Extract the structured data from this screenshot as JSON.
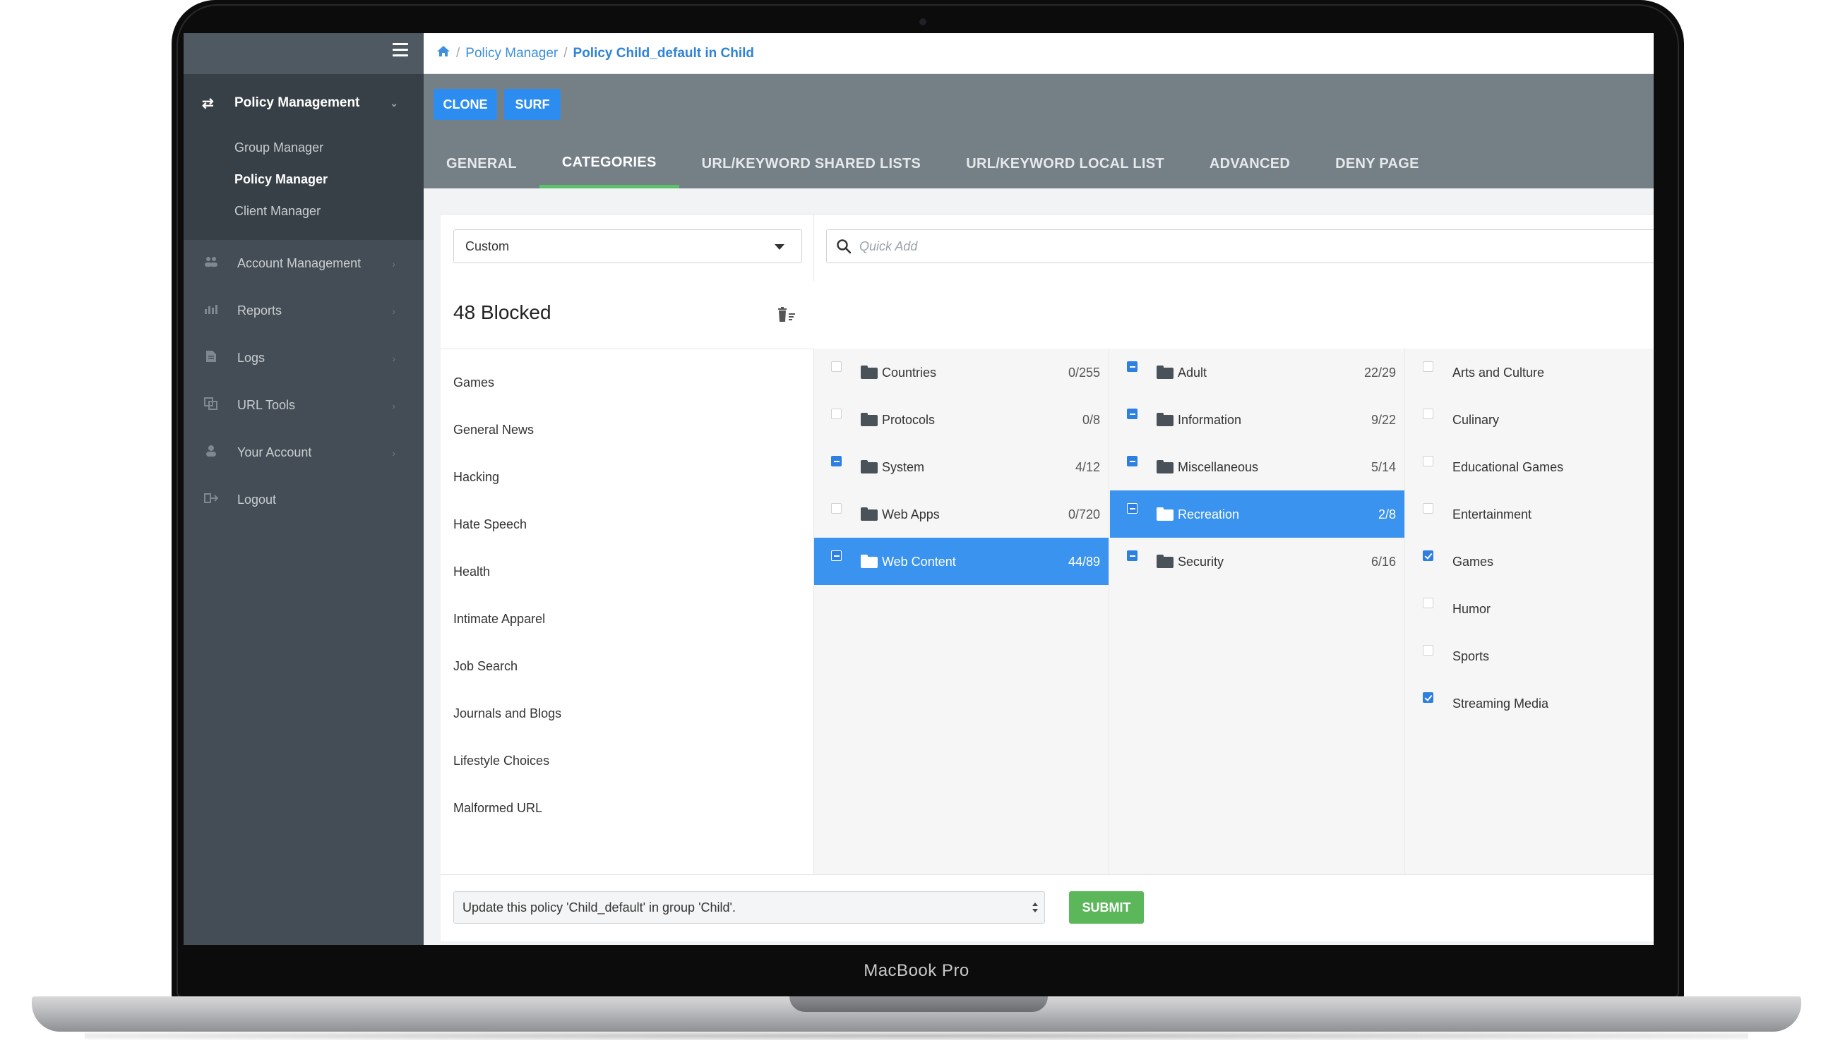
{
  "device": {
    "label": "MacBook Pro"
  },
  "breadcrumb": {
    "parent": "Policy Manager",
    "separator": "/",
    "current": "Policy Child_default in Child"
  },
  "sidebar": {
    "group": {
      "label": "Policy Management",
      "icon": "shuffle-icon",
      "items": [
        {
          "label": "Group Manager",
          "active": false
        },
        {
          "label": "Policy Manager",
          "active": true
        },
        {
          "label": "Client Manager",
          "active": false
        }
      ]
    },
    "items": [
      {
        "label": "Account Management",
        "icon": "users-icon"
      },
      {
        "label": "Reports",
        "icon": "bar-chart-icon"
      },
      {
        "label": "Logs",
        "icon": "file-icon"
      },
      {
        "label": "URL Tools",
        "icon": "copy-icon"
      },
      {
        "label": "Your Account",
        "icon": "user-icon"
      },
      {
        "label": "Logout",
        "icon": "sign-out-icon"
      }
    ]
  },
  "toolbar": {
    "clone_label": "CLONE",
    "surf_label": "SURF"
  },
  "tabs": [
    {
      "label": "GENERAL",
      "active": false
    },
    {
      "label": "CATEGORIES",
      "active": true
    },
    {
      "label": "URL/KEYWORD SHARED LISTS",
      "active": false
    },
    {
      "label": "URL/KEYWORD LOCAL LIST",
      "active": false
    },
    {
      "label": "ADVANCED",
      "active": false
    },
    {
      "label": "DENY PAGE",
      "active": false
    }
  ],
  "filter": {
    "selected": "Custom",
    "quick_add_placeholder": "Quick Add"
  },
  "blocked": {
    "title": "48 Blocked",
    "categories": [
      "Games",
      "General News",
      "Hacking",
      "Hate Speech",
      "Health",
      "Intimate Apparel",
      "Job Search",
      "Journals and Blogs",
      "Lifestyle Choices",
      "Malformed URL"
    ]
  },
  "columns": {
    "groups": [
      {
        "label": "Countries",
        "count": "0/255",
        "state": "none",
        "selected": false
      },
      {
        "label": "Protocols",
        "count": "0/8",
        "state": "none",
        "selected": false
      },
      {
        "label": "System",
        "count": "4/12",
        "state": "partial",
        "selected": false
      },
      {
        "label": "Web Apps",
        "count": "0/720",
        "state": "none",
        "selected": false
      },
      {
        "label": "Web Content",
        "count": "44/89",
        "state": "partial",
        "selected": true
      }
    ],
    "subgroups": [
      {
        "label": "Adult",
        "count": "22/29",
        "state": "partial",
        "selected": false
      },
      {
        "label": "Information",
        "count": "9/22",
        "state": "partial",
        "selected": false
      },
      {
        "label": "Miscellaneous",
        "count": "5/14",
        "state": "partial",
        "selected": false
      },
      {
        "label": "Recreation",
        "count": "2/8",
        "state": "partial",
        "selected": true
      },
      {
        "label": "Security",
        "count": "6/16",
        "state": "partial",
        "selected": false
      }
    ],
    "leaves": [
      {
        "label": "Arts and Culture",
        "checked": false
      },
      {
        "label": "Culinary",
        "checked": false
      },
      {
        "label": "Educational Games",
        "checked": false
      },
      {
        "label": "Entertainment",
        "checked": false
      },
      {
        "label": "Games",
        "checked": true
      },
      {
        "label": "Humor",
        "checked": false
      },
      {
        "label": "Sports",
        "checked": false
      },
      {
        "label": "Streaming Media",
        "checked": true
      }
    ]
  },
  "footer": {
    "policy_select_value": "Update this policy 'Child_default' in group 'Child'.",
    "submit_label": "SUBMIT"
  },
  "colors": {
    "accent_blue": "#2d8cf0",
    "submit_green": "#5cb65a",
    "tab_underline": "#5cc26a",
    "sidebar_bg": "#444d55"
  }
}
